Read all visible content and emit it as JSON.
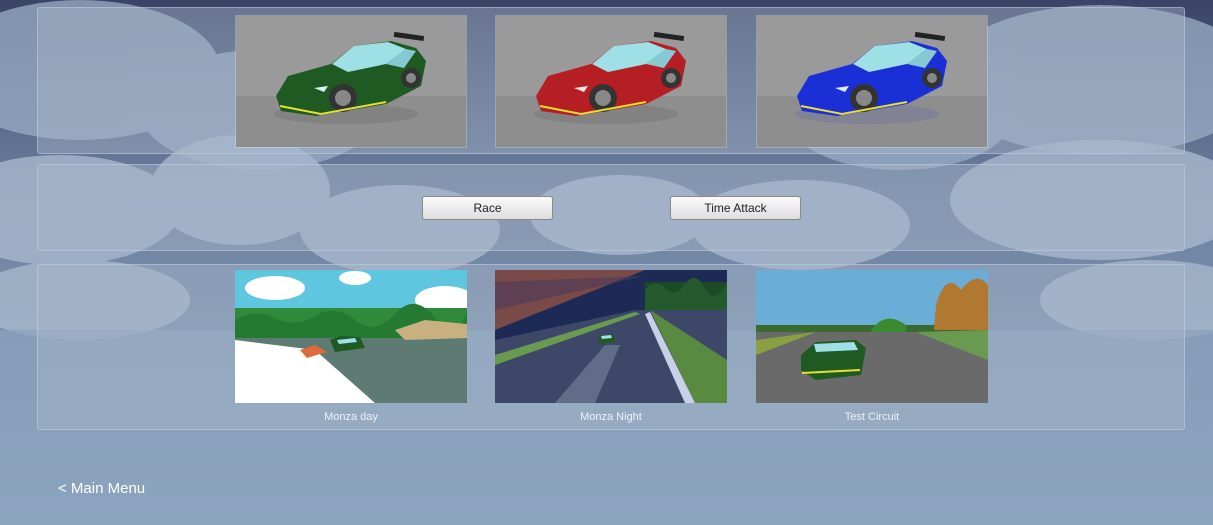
{
  "cars": [
    {
      "color": "#1f5a23",
      "icon": "green-car-preview"
    },
    {
      "color": "#b51e22",
      "icon": "red-car-preview"
    },
    {
      "color": "#1b2fd6",
      "icon": "blue-car-preview"
    }
  ],
  "modes": {
    "race_label": "Race",
    "time_attack_label": "Time Attack"
  },
  "tracks": [
    {
      "name": "Monza day",
      "icon": "monza-day-preview"
    },
    {
      "name": "Monza Night",
      "icon": "monza-night-preview"
    },
    {
      "name": "Test Circuit",
      "icon": "test-circuit-preview"
    }
  ],
  "nav": {
    "main_menu_label": "< Main Menu"
  }
}
